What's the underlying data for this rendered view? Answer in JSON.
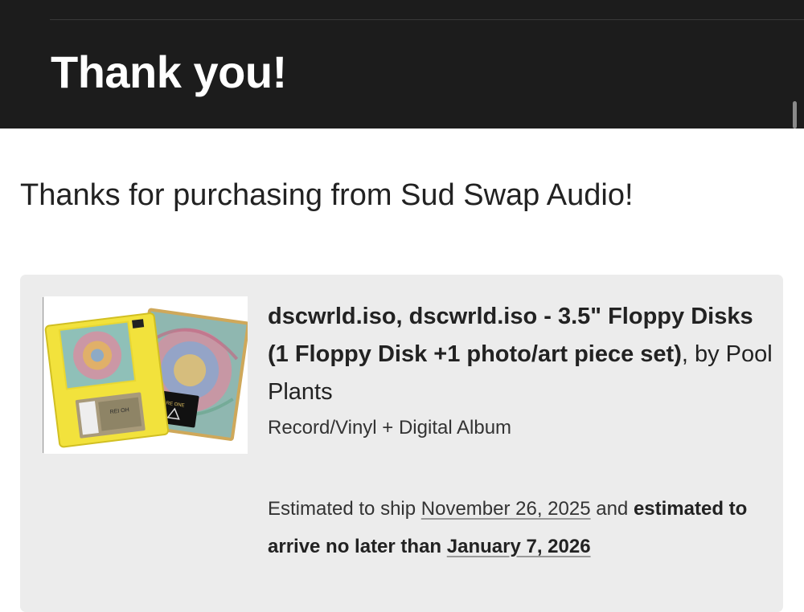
{
  "header": {
    "title": "Thank you!"
  },
  "intro": {
    "text": "Thanks for purchasing from Sud Swap Audio!"
  },
  "order_item": {
    "title_bold": "dscwrld.iso, dscwrld.iso - 3.5\" Floppy Disks (1 Floppy Disk +1 photo/art piece set)",
    "title_suffix": ", by Pool Plants",
    "type": "Record/Vinyl + Digital Album",
    "image_alt": "floppy-disk-product-photo"
  },
  "shipping": {
    "prefix": "Estimated to ship ",
    "ship_date": "November 26, 2025",
    "middle": " and ",
    "arrive_label": "estimated to arrive no later than ",
    "arrive_date": "January 7, 2026"
  },
  "colors": {
    "header_bg": "#1c1c1c",
    "card_bg": "#ececec",
    "text": "#222222"
  }
}
